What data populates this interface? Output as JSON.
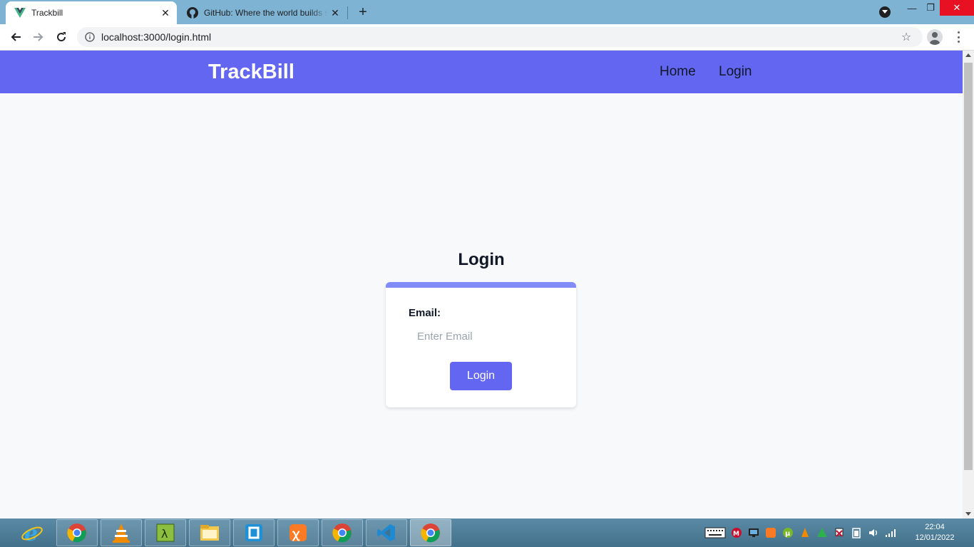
{
  "browser": {
    "tabs": [
      {
        "title": "Trackbill",
        "active": true,
        "icon": "vue-icon"
      },
      {
        "title": "GitHub: Where the world builds software",
        "active": false,
        "icon": "github-icon"
      }
    ],
    "new_tab_label": "+",
    "address": "localhost:3000/login.html"
  },
  "site": {
    "brand": "TrackBill",
    "nav": [
      {
        "label": "Home"
      },
      {
        "label": "Login"
      }
    ],
    "brand_color": "#6366f1",
    "accent_color": "#818cf8"
  },
  "login": {
    "title": "Login",
    "email_label": "Email:",
    "email_placeholder": "Enter Email",
    "email_value": "",
    "submit_label": "Login"
  },
  "taskbar": {
    "apps": [
      "ie-icon",
      "chrome-icon",
      "vlc-icon",
      "tool-icon",
      "file-explorer-icon",
      "app-icon",
      "xampp-icon",
      "chrome-icon",
      "vscode-icon",
      "chrome-icon"
    ],
    "clock": {
      "time": "22:04",
      "date": "12/01/2022"
    }
  }
}
